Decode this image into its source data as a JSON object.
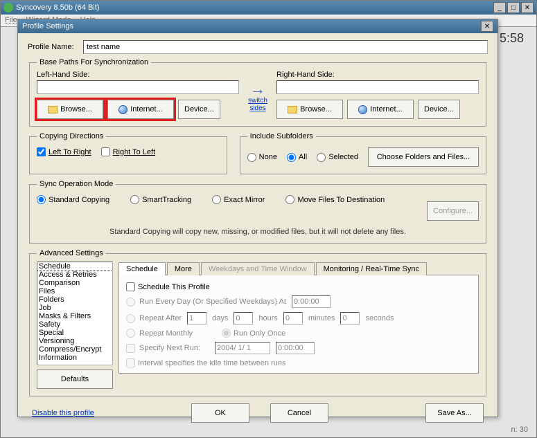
{
  "mainWindow": {
    "title": "Syncovery 8.50b (64 Bit)",
    "menu": {
      "file": "File",
      "wizard": "Wizard Mode",
      "help": "Help"
    },
    "time": "5:58",
    "status": "n: 30"
  },
  "dialog": {
    "title": "Profile Settings",
    "profileNameLabel": "Profile Name:",
    "profileNameValue": "test name",
    "basePaths": {
      "legend": "Base Paths For Synchronization",
      "leftLabel": "Left-Hand Side:",
      "rightLabel": "Right-Hand Side:",
      "browse": "Browse...",
      "internet": "Internet...",
      "device": "Device...",
      "switch": "switch sides"
    },
    "copying": {
      "legend": "Copying Directions",
      "ltr": "Left To Right",
      "rtl": "Right To Left"
    },
    "include": {
      "legend": "Include Subfolders",
      "none": "None",
      "all": "All",
      "selected": "Selected",
      "choose": "Choose Folders and Files..."
    },
    "sync": {
      "legend": "Sync Operation Mode",
      "standard": "Standard Copying",
      "smart": "SmartTracking",
      "exact": "Exact Mirror",
      "move": "Move Files To Destination",
      "desc": "Standard Copying will copy new, missing, or modified files, but it will not delete any files.",
      "configure": "Configure..."
    },
    "advanced": {
      "legend": "Advanced Settings",
      "list": [
        "Schedule",
        "Access & Retries",
        "Comparison",
        "Files",
        "Folders",
        "Job",
        "Masks & Filters",
        "Safety",
        "Special",
        "Versioning",
        "Compress/Encrypt",
        "Information"
      ],
      "defaults": "Defaults",
      "tabs": {
        "schedule": "Schedule",
        "more": "More",
        "weekdays": "Weekdays and Time Window",
        "monitoring": "Monitoring / Real-Time Sync"
      },
      "schedTab": {
        "scheduleThis": "Schedule This Profile",
        "runEvery": "Run Every Day (Or Specified Weekdays) At",
        "runEveryTime": "0:00:00",
        "repeatAfter": "Repeat After",
        "days": "days",
        "hours": "hours",
        "minutes": "minutes",
        "seconds": "seconds",
        "repeatDays": "1",
        "repeatHours": "0",
        "repeatMinutes": "0",
        "repeatSeconds": "0",
        "repeatMonthly": "Repeat Monthly",
        "runOnce": "Run Only Once",
        "specifyNext": "Specify Next Run:",
        "nextDate": "2004/ 1/ 1",
        "nextTime": "0:00:00",
        "interval": "Interval specifies the idle time between runs"
      }
    },
    "footer": {
      "disable": "Disable this profile",
      "ok": "OK",
      "cancel": "Cancel",
      "saveAs": "Save As..."
    }
  }
}
